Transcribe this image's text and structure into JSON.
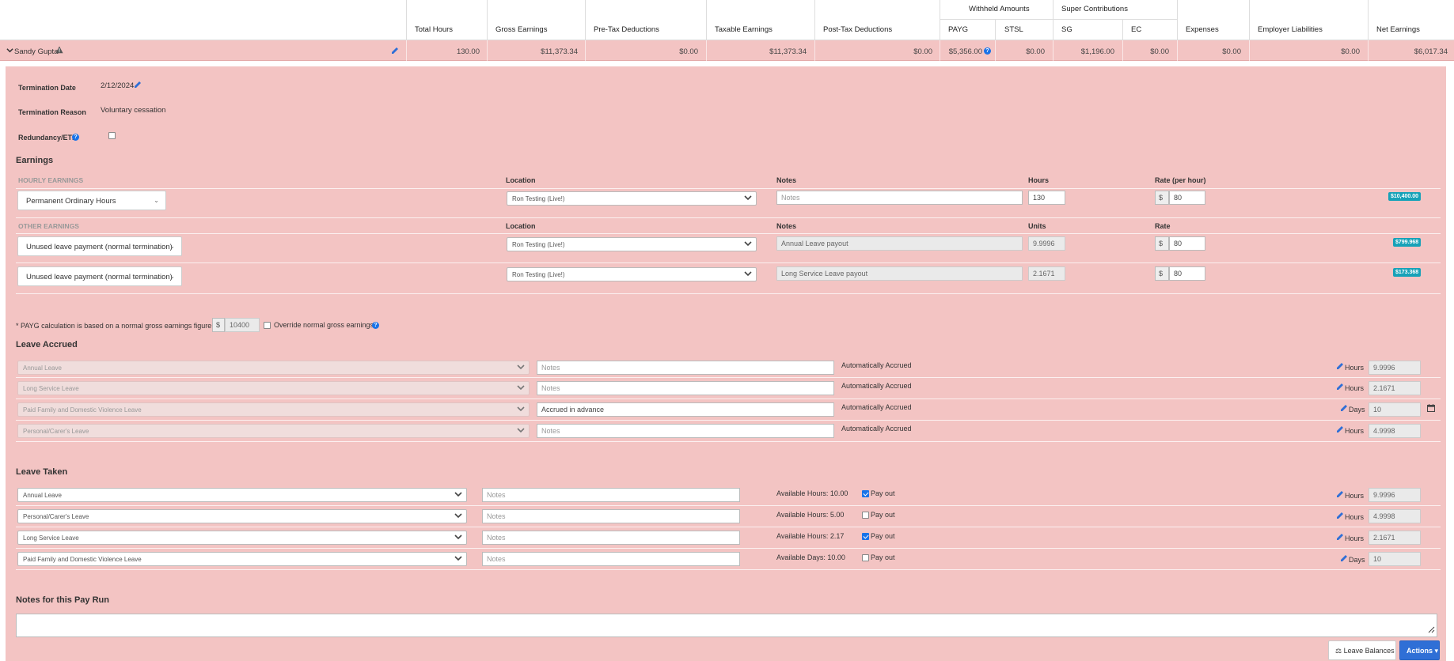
{
  "header": {
    "group_withheld": "Withheld Amounts",
    "group_super": "Super Contributions",
    "columns": [
      "Total Hours",
      "Gross Earnings",
      "Pre-Tax Deductions",
      "Taxable Earnings",
      "Post-Tax Deductions",
      "PAYG",
      "STSL",
      "SG",
      "EC",
      "Expenses",
      "Employer Liabilities",
      "Net Earnings"
    ]
  },
  "employee": {
    "name": "Sandy Gupta",
    "values": [
      "130.00",
      "$11,373.34",
      "$0.00",
      "$11,373.34",
      "$0.00",
      "$5,356.00",
      "$0.00",
      "$1,196.00",
      "$0.00",
      "$0.00",
      "$0.00",
      "$6,017.34"
    ]
  },
  "termination": {
    "date_label": "Termination Date",
    "date_value": "2/12/2024",
    "reason_label": "Termination Reason",
    "reason_value": "Voluntary cessation",
    "redundancy_label": "Redundancy/ETP",
    "redundancy_checked": false
  },
  "earnings": {
    "title": "Earnings",
    "hourly": {
      "subtitle": "HOURLY EARNINGS",
      "col_location": "Location",
      "col_notes": "Notes",
      "col_hours": "Hours",
      "col_rate": "Rate (per hour)",
      "rows": [
        {
          "type": "Permanent Ordinary Hours",
          "location": "Ron Testing (Live!)",
          "notes": "",
          "notes_placeholder": "Notes",
          "qty": "130",
          "currency": "$",
          "rate": "80",
          "total": "$10,400.00"
        }
      ]
    },
    "other": {
      "subtitle": "OTHER EARNINGS",
      "col_location": "Location",
      "col_notes": "Notes",
      "col_units": "Units",
      "col_rate": "Rate",
      "rows": [
        {
          "type": "Unused leave payment (normal termination)",
          "location": "Ron Testing (Live!)",
          "notes": "Annual Leave payout",
          "qty": "9.9996",
          "currency": "$",
          "rate": "80",
          "total": "$799.968"
        },
        {
          "type": "Unused leave payment (normal termination)",
          "location": "Ron Testing (Live!)",
          "notes": "Long Service Leave payout",
          "qty": "2.1671",
          "currency": "$",
          "rate": "80",
          "total": "$173.368"
        }
      ]
    }
  },
  "payg_note": {
    "text": "* PAYG calculation is based on a normal gross earnings figure of",
    "currency": "$",
    "value": "10400",
    "override_label": "Override normal gross earnings"
  },
  "leave_accrued": {
    "title": "Leave Accrued",
    "rows": [
      {
        "type": "Annual Leave",
        "notes": "",
        "notes_placeholder": "Notes",
        "status": "Automatically Accrued",
        "unit": "Hours",
        "value": "9.9996"
      },
      {
        "type": "Long Service Leave",
        "notes": "",
        "notes_placeholder": "Notes",
        "status": "Automatically Accrued",
        "unit": "Hours",
        "value": "2.1671"
      },
      {
        "type": "Paid Family and Domestic Violence Leave",
        "notes": "Accrued in advance",
        "notes_placeholder": "Notes",
        "status": "Automatically Accrued",
        "unit": "Days",
        "value": "10"
      },
      {
        "type": "Personal/Carer's Leave",
        "notes": "",
        "notes_placeholder": "Notes",
        "status": "Automatically Accrued",
        "unit": "Hours",
        "value": "4.9998"
      }
    ]
  },
  "leave_taken": {
    "title": "Leave Taken",
    "pay_out_label": "Pay out",
    "rows": [
      {
        "type": "Annual Leave",
        "notes_placeholder": "Notes",
        "available": "Available Hours: 10.00",
        "pay_out": true,
        "unit": "Hours",
        "value": "9.9996"
      },
      {
        "type": "Personal/Carer's Leave",
        "notes_placeholder": "Notes",
        "available": "Available Hours: 5.00",
        "pay_out": false,
        "unit": "Hours",
        "value": "4.9998"
      },
      {
        "type": "Long Service Leave",
        "notes_placeholder": "Notes",
        "available": "Available Hours: 2.17",
        "pay_out": true,
        "unit": "Hours",
        "value": "2.1671"
      },
      {
        "type": "Paid Family and Domestic Violence Leave",
        "notes_placeholder": "Notes",
        "available": "Available Days: 10.00",
        "pay_out": false,
        "unit": "Days",
        "value": "10"
      }
    ]
  },
  "pay_run_notes": {
    "title": "Notes for this Pay Run",
    "value": ""
  },
  "buttons": {
    "leave_balances": "Leave Balances",
    "actions": "Actions"
  },
  "colors": {
    "panel_bg": "#f3c4c3",
    "badge": "#17a2b8",
    "primary": "#2f6fd6",
    "accent_blue": "#1a73e8"
  }
}
